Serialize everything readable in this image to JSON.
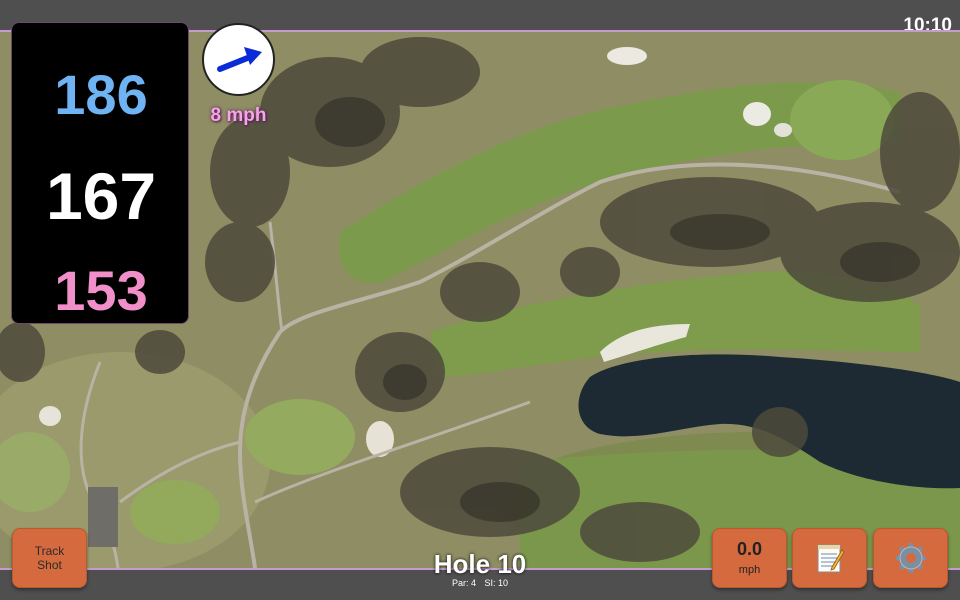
{
  "status": {
    "time": "10:10"
  },
  "distances": {
    "back": "186",
    "center": "167",
    "front": "153"
  },
  "wind": {
    "speed": "8 mph",
    "arrow_icon": "wind-direction-arrow-icon",
    "arrow_color": "#0a2cd6"
  },
  "buttons": {
    "track_shot_line1": "Track",
    "track_shot_line2": "Shot",
    "speed_value": "0.0",
    "speed_unit": "mph",
    "notes_icon": "notepad-icon",
    "settings_icon": "gear-icon"
  },
  "hole": {
    "title": "Hole 10",
    "par": "Par: 4",
    "si": "SI: 10"
  },
  "colors": {
    "accent": "#d56a3e",
    "back_distance": "#6fb3f2",
    "center_distance": "#ffffff",
    "front_distance": "#f08fc9",
    "wind_text": "#f4a6e6"
  }
}
